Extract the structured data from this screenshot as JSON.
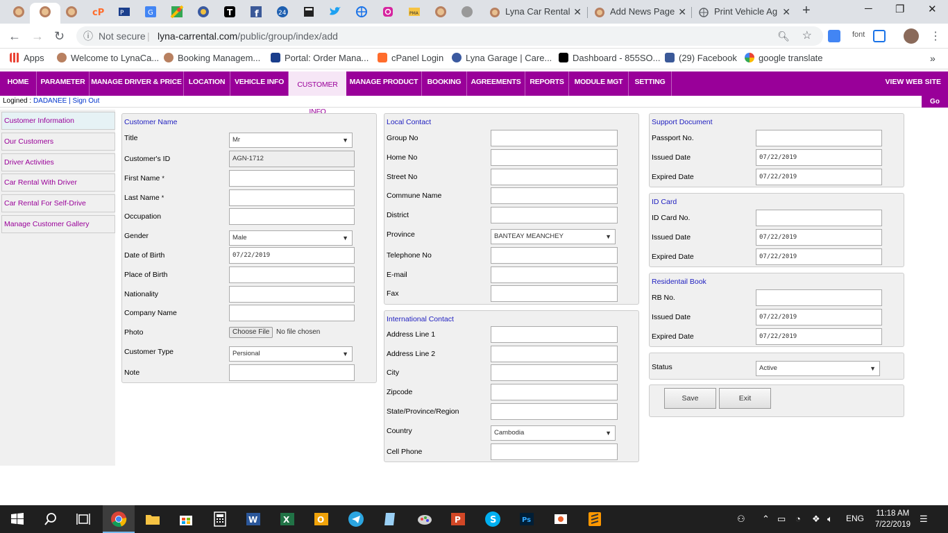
{
  "browser": {
    "tabs": [
      {
        "label": "Lyna Car Rental",
        "icon": "lyna-favicon"
      },
      {
        "label": "Add News Page",
        "icon": "lyna-favicon"
      },
      {
        "label": "Print Vehicle Ag",
        "icon": "globe-icon"
      }
    ],
    "address": {
      "security": "Not secure",
      "host": "lyna-carrental.com",
      "path": "/public/group/index/add"
    },
    "extension_label": "font",
    "bookmarks": [
      {
        "label": "Apps"
      },
      {
        "label": "Welcome to LynaCa..."
      },
      {
        "label": "Booking Managem..."
      },
      {
        "label": "Portal: Order Mana..."
      },
      {
        "label": "cPanel Login"
      },
      {
        "label": "Lyna Garage | Care..."
      },
      {
        "label": "Dashboard - 855SO..."
      },
      {
        "label": "(29) Facebook"
      },
      {
        "label": "google translate"
      }
    ],
    "bookmarks_more": "»"
  },
  "menu": {
    "items": [
      "HOME",
      "PARAMETER",
      "MANAGE DRIVER & PRICE",
      "LOCATION",
      "VEHICLE INFO",
      "CUSTOMER INFO",
      "MANAGE PRODUCT",
      "BOOKING",
      "AGREEMENTS",
      "REPORTS",
      "MODULE MGT",
      "SETTING"
    ],
    "active": "CUSTOMER INFO",
    "right": "VIEW WEB SITE"
  },
  "login": {
    "prefix": "Logined :",
    "user": "DADANEE",
    "separator": "|",
    "signout": "Sign Out",
    "go_back": "Go Back"
  },
  "sidebar": [
    "Customer Information",
    "Our Customers",
    "Driver Activities",
    "Car Rental With Driver",
    "Car Rental For Self-Drive",
    "Manage Customer Gallery"
  ],
  "customer": {
    "title": "Customer Name",
    "fields": {
      "title_label": "Title",
      "title_value": "Mr",
      "id_label": "Customer's ID",
      "id_value": "AGN-1712",
      "first_label": "First Name",
      "last_label": "Last Name",
      "required_mark": "*",
      "occupation_label": "Occupation",
      "gender_label": "Gender",
      "gender_value": "Male",
      "dob_label": "Date of Birth",
      "dob_value": "07/22/2019",
      "pob_label": "Place of Birth",
      "nationality_label": "Nationality",
      "company_label": "Company Name",
      "photo_label": "Photo",
      "choose_file": "Choose File",
      "no_file": "No file chosen",
      "type_label": "Customer Type",
      "type_value": "Persional",
      "note_label": "Note"
    }
  },
  "local": {
    "title": "Local Contact",
    "labels": [
      "Group No",
      "Home No",
      "Street No",
      "Commune Name",
      "District",
      "Province",
      "Telephone No",
      "E-mail",
      "Fax"
    ],
    "province_value": "BANTEAY MEANCHEY"
  },
  "international": {
    "title": "International Contact",
    "labels": [
      "Address Line 1",
      "Address Line 2",
      "City",
      "Zipcode",
      "State/Province/Region",
      "Country",
      "Cell Phone"
    ],
    "country_value": "Cambodia"
  },
  "support": {
    "title": "Support Document",
    "no_label": "Passport No.",
    "issued_label": "Issued Date",
    "issued": "07/22/2019",
    "expired_label": "Expired Date",
    "expired": "07/22/2019"
  },
  "idcard": {
    "title": "ID Card",
    "no_label": "ID Card No.",
    "issued_label": "Issued Date",
    "issued": "07/22/2019",
    "expired_label": "Expired Date",
    "expired": "07/22/2019"
  },
  "residential": {
    "title": "Residentail Book",
    "no_label": "RB No.",
    "issued_label": "Issued Date",
    "issued": "07/22/2019",
    "expired_label": "Expired Date",
    "expired": "07/22/2019"
  },
  "status": {
    "label": "Status",
    "value": "Active"
  },
  "actions": {
    "save": "Save",
    "exit": "Exit"
  },
  "taskbar": {
    "lang": "ENG",
    "time": "11:18 AM",
    "date": "7/22/2019"
  },
  "colors": {
    "menu": "#990099",
    "panel": "#f0f0f0",
    "title_blue": "#2020c0"
  }
}
